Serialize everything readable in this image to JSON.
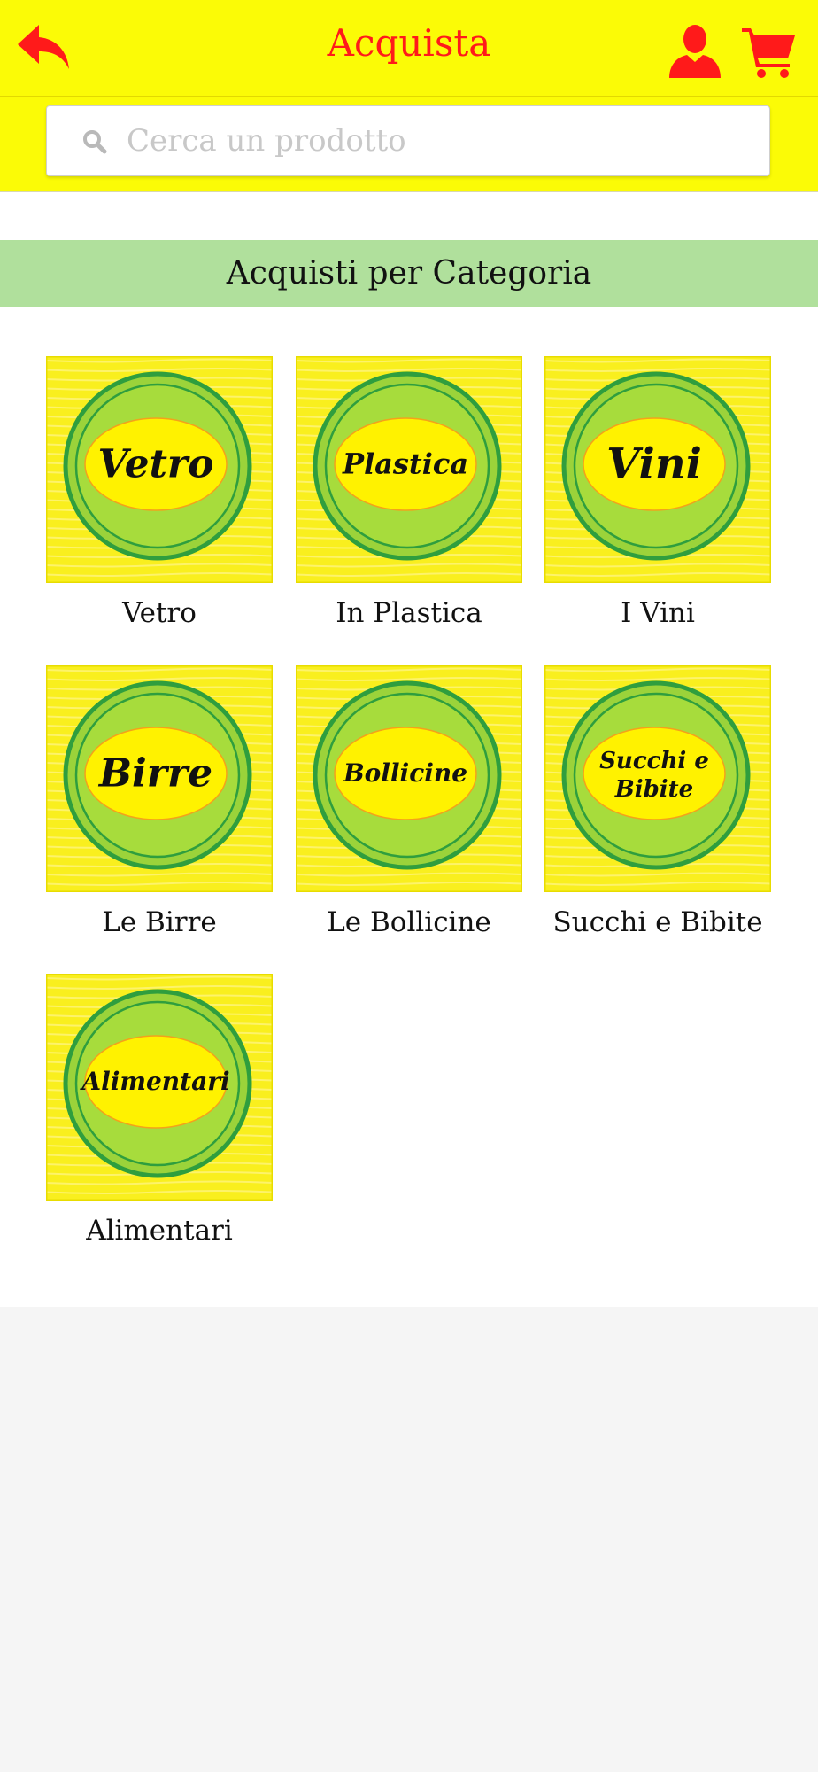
{
  "header": {
    "title": "Acquista",
    "back_icon": "back-arrow-icon",
    "user_icon": "user-icon",
    "cart_icon": "cart-icon",
    "accent_color": "#ff1a1a",
    "background_color": "#fbfb06"
  },
  "search": {
    "placeholder": "Cerca un prodotto",
    "value": "",
    "icon": "search-icon"
  },
  "section": {
    "title": "Acquisti per Categoria",
    "background_color": "#b0e09c"
  },
  "categories": [
    {
      "badge": "Vetro",
      "label": "Vetro"
    },
    {
      "badge": "Plastica",
      "label": "In Plastica"
    },
    {
      "badge": "Vini",
      "label": "I Vini"
    },
    {
      "badge": "Birre",
      "label": "Le Birre"
    },
    {
      "badge": "Bollicine",
      "label": "Le Bollicine"
    },
    {
      "badge": "Succhi e Bibite",
      "label": "Succhi e Bibite"
    },
    {
      "badge": "Alimentari",
      "label": "Alimentari"
    }
  ]
}
